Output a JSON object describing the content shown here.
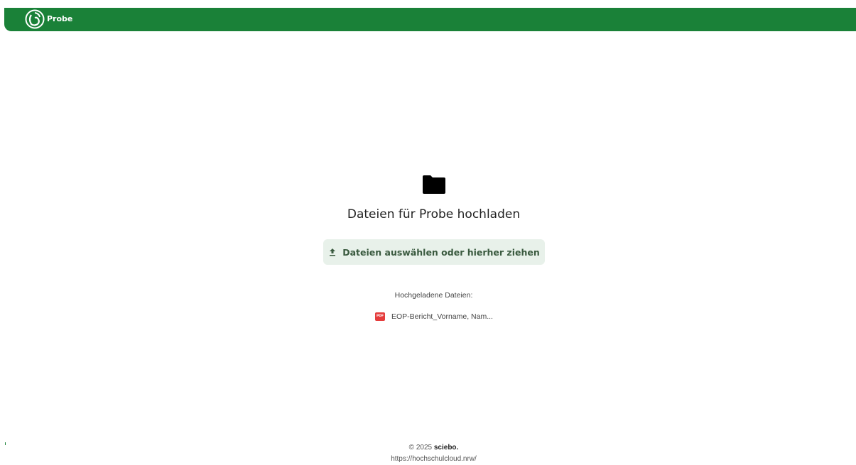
{
  "header": {
    "app_name": "Probe",
    "brand_color": "#1a8138",
    "logo_icon": "sciebo-logo-icon"
  },
  "main": {
    "folder_icon": "folder-icon",
    "title": "Dateien für Probe hochladen",
    "upload_button_label": "Dateien auswählen oder hierher ziehen",
    "upload_icon": "upload-icon",
    "uploaded_heading": "Hochgeladene Dateien:",
    "files": [
      {
        "icon": "pdf-icon",
        "icon_label": "PDF",
        "name": "EOP-Bericht_Vorname, Nam..."
      }
    ]
  },
  "footer": {
    "copyright_prefix": "© 2025",
    "brand": "sciebo.",
    "url": "https://hochschulcloud.nrw/"
  }
}
